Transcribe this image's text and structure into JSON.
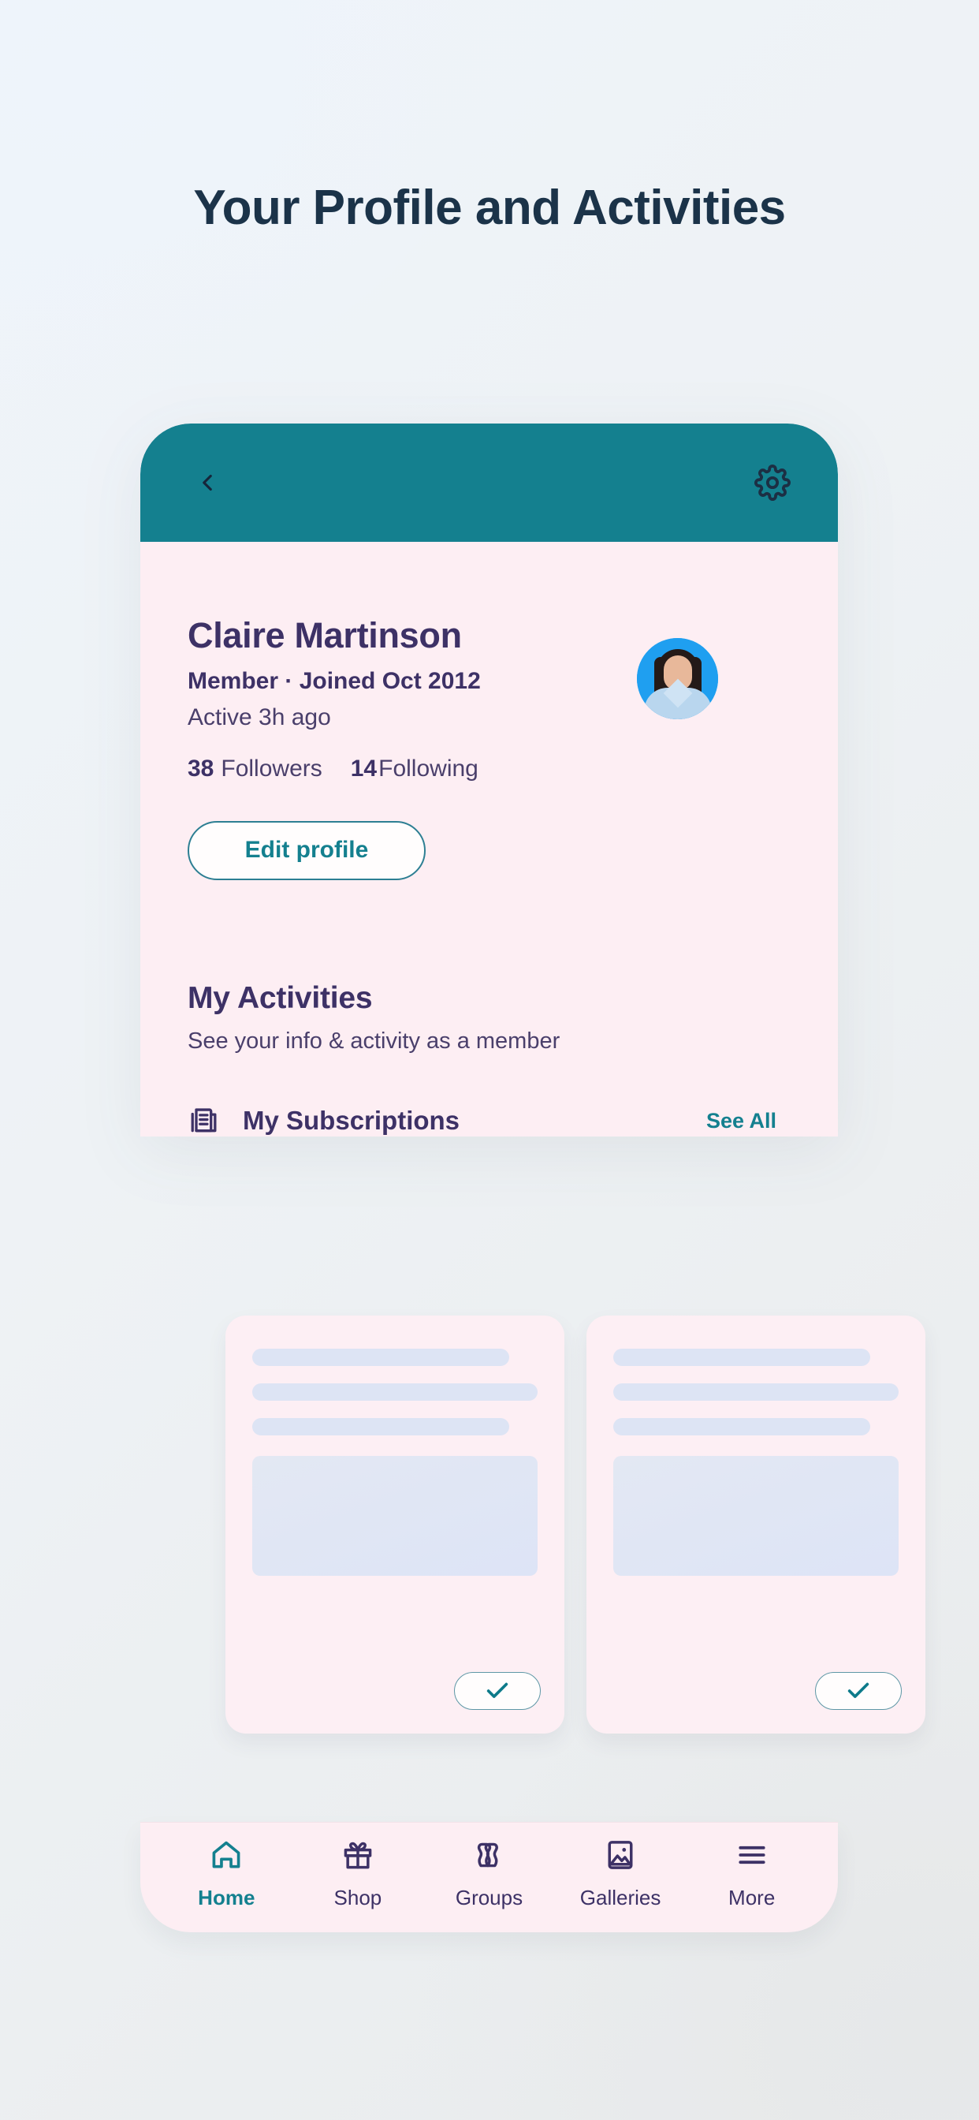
{
  "page": {
    "title": "Your Profile and Activities",
    "title_color": "#1b3349",
    "background_start": "#eff4fa",
    "background_end": "#e9ebec"
  },
  "appbar": {
    "background": "#14808f",
    "back_icon": "chevron-left-icon",
    "settings_icon": "gear-icon"
  },
  "profile": {
    "name": "Claire Martinson",
    "meta": "Member · Joined Oct 2012",
    "active": "Active 3h ago",
    "followers_count": "38",
    "followers_label": "Followers",
    "following_count": "14",
    "following_label": "Following",
    "edit_button": "Edit profile",
    "accent_color": "#14808f",
    "name_color": "#3d3166",
    "avatar": "user-photo-avatar"
  },
  "activities": {
    "heading": "My Activities",
    "subheading": "See your info & activity as a member",
    "subscriptions": {
      "icon": "subscriptions-document-icon",
      "label": "My Subscriptions",
      "see_all": "See All"
    }
  },
  "skeleton_cards": [
    {
      "check_icon": "check-icon",
      "lines": 3
    },
    {
      "check_icon": "check-icon",
      "lines": 3
    }
  ],
  "bottom_nav": {
    "items": [
      {
        "label": "Home",
        "icon": "home-icon",
        "active": true
      },
      {
        "label": "Shop",
        "icon": "gift-icon",
        "active": false
      },
      {
        "label": "Groups",
        "icon": "people-icon",
        "active": false
      },
      {
        "label": "Galleries",
        "icon": "image-icon",
        "active": false
      },
      {
        "label": "More",
        "icon": "hamburger-menu-icon",
        "active": false
      }
    ]
  }
}
